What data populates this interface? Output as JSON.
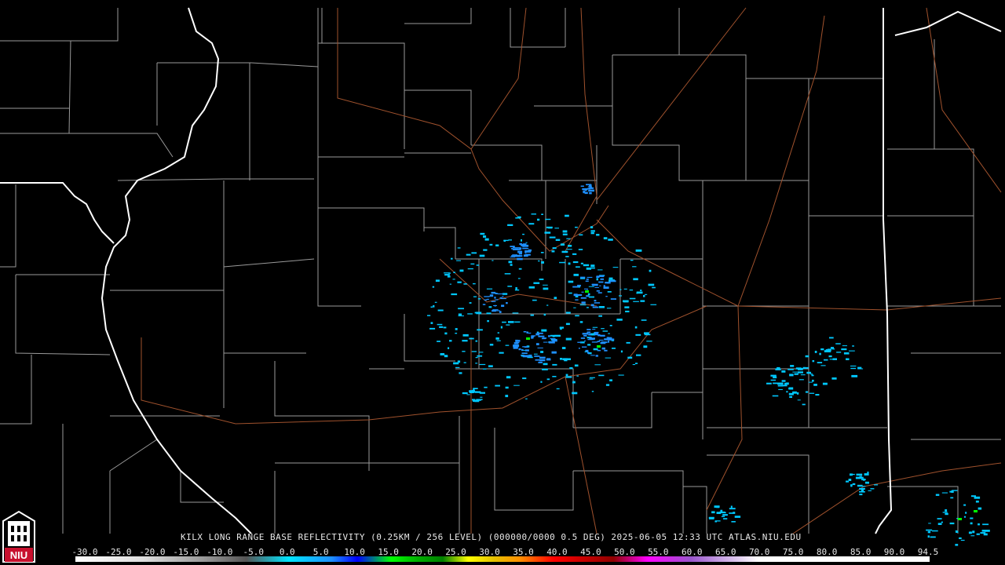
{
  "product_caption": "KILX LONG RANGE BASE REFLECTIVITY (0.25KM / 256 LEVEL) (000000/0000 0.5 DEG) 2025-06-05 12:33 UTC  ATLAS.NIU.EDU",
  "colorbar": {
    "ticks": [
      "-30.0",
      "-25.0",
      "-20.0",
      "-15.0",
      "-10.0",
      "-5.0",
      "0.0",
      "5.0",
      "10.0",
      "15.0",
      "20.0",
      "25.0",
      "30.0",
      "35.0",
      "40.0",
      "45.0",
      "50.0",
      "55.0",
      "60.0",
      "65.0",
      "70.0",
      "75.0",
      "80.0",
      "85.0",
      "90.0",
      "94.5"
    ]
  },
  "logo": {
    "text": "NIU"
  },
  "colors": {
    "background": "#000000",
    "state_border": "#ffffff",
    "county_border": "#a0a0a0",
    "highway": "#a0522d",
    "echo_light": "#00c8ff",
    "echo_mid": "#1e90ff",
    "echo_heavy": "#00ff00"
  }
}
